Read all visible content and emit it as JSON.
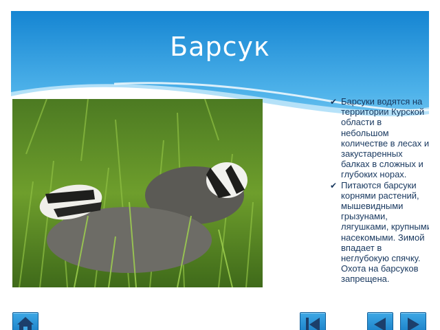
{
  "slide": {
    "title": "Барсук",
    "bullets": [
      "Барсуки водятся на территории Курской области в небольшом количестве в лесах и закустаренных балках в сложных и глубоких норах.",
      "Питаются барсуки корнями растений, мышевидными грызунами, лягушками, крупными насекомыми. Зимой впадает в неглубокую спячку. Охота на барсуков запрещена."
    ],
    "bullet_icon": "checkmark-icon",
    "photo_subject": "two badgers in grass"
  },
  "navigation": {
    "home_icon": "home-icon",
    "first_icon": "skip-to-start-icon",
    "prev_icon": "arrow-left-icon",
    "next_icon": "arrow-right-icon"
  },
  "colors": {
    "header_top": "#1b8fd8",
    "header_bottom": "#7cc9f2",
    "body_text": "#17375e",
    "nav_button": "#2a93d5"
  }
}
